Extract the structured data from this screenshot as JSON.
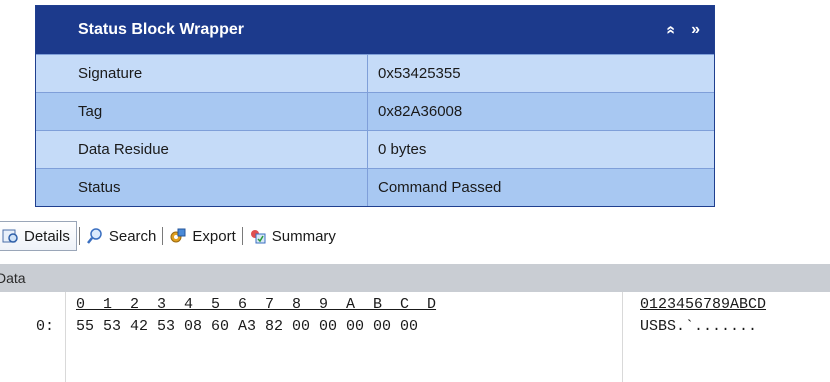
{
  "status_block": {
    "title": "Status Block Wrapper",
    "collapse_glyph": "«",
    "expand_glyph": "»",
    "rows": [
      {
        "label": "Signature",
        "value": "0x53425355"
      },
      {
        "label": "Tag",
        "value": "0x82A36008"
      },
      {
        "label": "Data Residue",
        "value": "0 bytes"
      },
      {
        "label": "Status",
        "value": "Command Passed"
      }
    ]
  },
  "toolbar": {
    "details_label": "Details",
    "search_label": "Search",
    "export_label": "Export",
    "summary_label": "Summary"
  },
  "data_panel": {
    "title": "Data",
    "hex_header": "0  1  2  3  4  5  6  7  8  9  A  B  C  D",
    "ascii_header": "0123456789ABCD",
    "rows": [
      {
        "offset": "0:",
        "hex": "55 53 42 53 08 60 A3 82 00 00 00 00 00",
        "ascii": "USBS.`......."
      }
    ]
  },
  "colors": {
    "header_bg": "#1c3a8c",
    "row_light": "#c5dbf8",
    "row_dark": "#a8c8f2"
  }
}
